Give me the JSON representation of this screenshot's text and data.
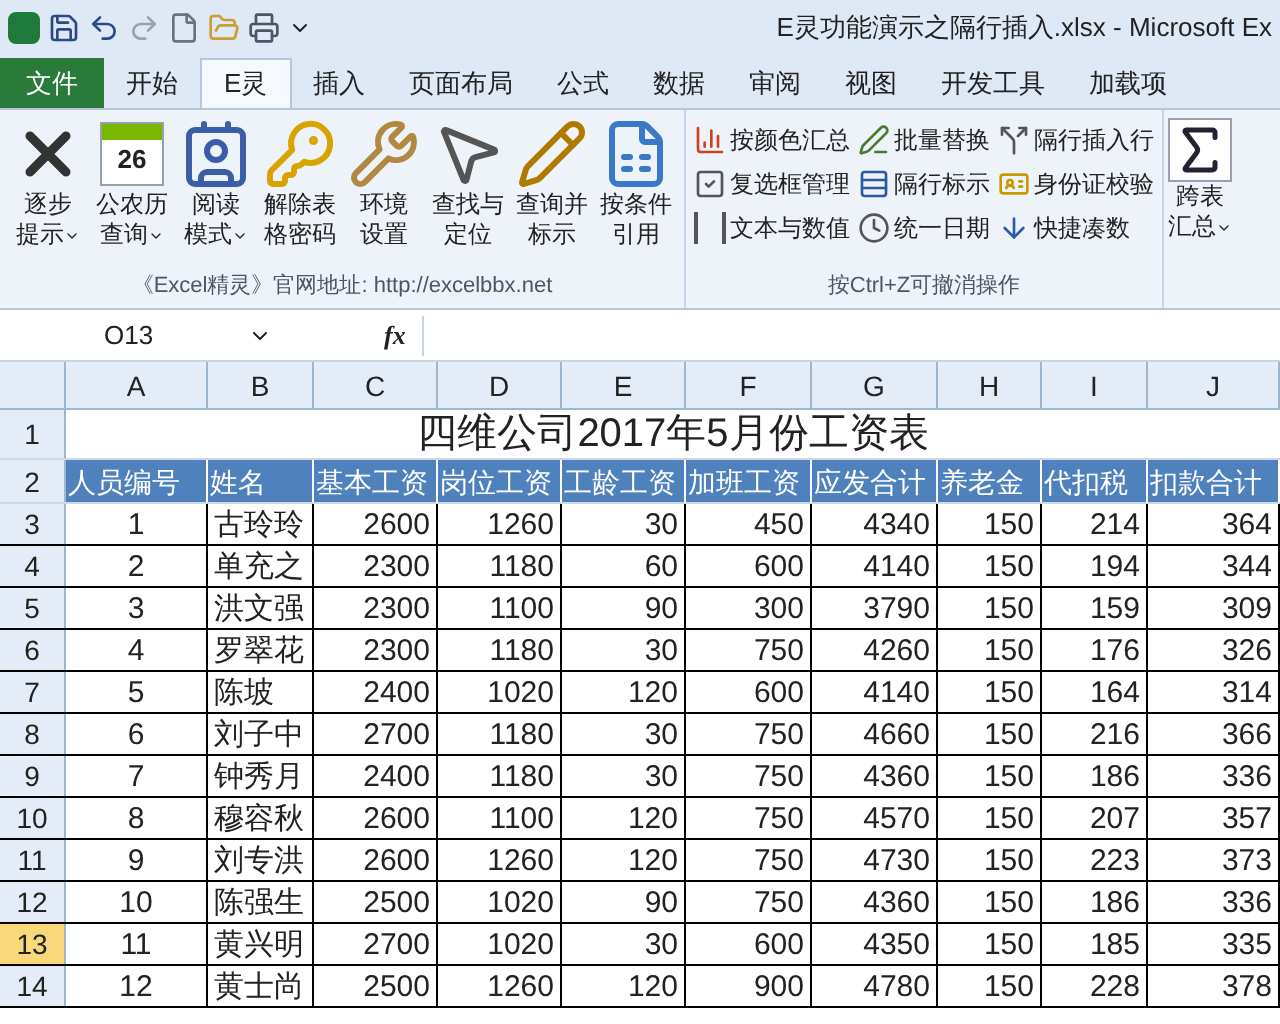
{
  "window": {
    "title": "E灵功能演示之隔行插入.xlsx - Microsoft Ex"
  },
  "tabs": [
    {
      "label": "文件",
      "selected": false,
      "kind": "file"
    },
    {
      "label": "开始",
      "selected": false
    },
    {
      "label": "E灵",
      "selected": true
    },
    {
      "label": "插入",
      "selected": false
    },
    {
      "label": "页面布局",
      "selected": false
    },
    {
      "label": "公式",
      "selected": false
    },
    {
      "label": "数据",
      "selected": false
    },
    {
      "label": "审阅",
      "selected": false
    },
    {
      "label": "视图",
      "selected": false
    },
    {
      "label": "开发工具",
      "selected": false
    },
    {
      "label": "加载项",
      "selected": false
    }
  ],
  "ribbon": {
    "group_1": {
      "buttons": [
        {
          "kind": "cross",
          "lines": [
            "逐步",
            "提示"
          ],
          "dropdown": true
        },
        {
          "kind": "calendar",
          "icon_text": "26",
          "lines": [
            "公农历",
            "查询"
          ],
          "dropdown": true
        },
        {
          "kind": "card",
          "lines": [
            "阅读",
            "模式"
          ],
          "dropdown": true
        },
        {
          "kind": "key",
          "lines": [
            "解除表",
            "格密码"
          ],
          "dropdown": false
        },
        {
          "kind": "tools",
          "lines": [
            "环境",
            "设置"
          ],
          "dropdown": false
        },
        {
          "kind": "pointer",
          "lines": [
            "查找与",
            "定位"
          ],
          "dropdown": false
        },
        {
          "kind": "pencil",
          "lines": [
            "查询并",
            "标示"
          ],
          "dropdown": false
        },
        {
          "kind": "sheet",
          "lines": [
            "按条件",
            "引用"
          ],
          "dropdown": false
        }
      ],
      "label": "《Excel精灵》官网地址: http://excelbbx.net"
    },
    "group_2": {
      "buttons": [
        {
          "kind": "bars",
          "label": "按颜色汇总"
        },
        {
          "kind": "check",
          "label": "复选框管理"
        },
        {
          "kind": "brackets",
          "label": "文本与数值"
        },
        {
          "kind": "pen",
          "label": "批量替换"
        },
        {
          "kind": "rows",
          "label": "隔行标示"
        },
        {
          "kind": "clock",
          "label": "统一日期"
        },
        {
          "kind": "insert",
          "label": "隔行插入行"
        },
        {
          "kind": "id",
          "label": "身份证校验"
        },
        {
          "kind": "down",
          "label": "快捷凑数"
        }
      ],
      "label": "按Ctrl+Z可撤消操作"
    },
    "group_3": {
      "lines": [
        "跨表",
        "汇总"
      ],
      "dropdown": true
    }
  },
  "formula_bar": {
    "name_box": "O13",
    "function_label": "fx"
  },
  "sheet": {
    "columns": [
      "A",
      "B",
      "C",
      "D",
      "E",
      "F",
      "G",
      "H",
      "I",
      "J"
    ],
    "title_row": {
      "number": "1",
      "title": "四维公司2017年5月份工资表"
    },
    "header_row": {
      "number": "2",
      "cells": [
        "人员编号",
        "姓名",
        "基本工资",
        "岗位工资",
        "工龄工资",
        "加班工资",
        "应发合计",
        "养老金",
        "代扣税",
        "扣款合计"
      ]
    },
    "rows": [
      {
        "number": "3",
        "selected": false,
        "cells": [
          "1",
          "古玲玲",
          "2600",
          "1260",
          "30",
          "450",
          "4340",
          "150",
          "214",
          "364"
        ]
      },
      {
        "number": "4",
        "selected": false,
        "cells": [
          "2",
          "单充之",
          "2300",
          "1180",
          "60",
          "600",
          "4140",
          "150",
          "194",
          "344"
        ]
      },
      {
        "number": "5",
        "selected": false,
        "cells": [
          "3",
          "洪文强",
          "2300",
          "1100",
          "90",
          "300",
          "3790",
          "150",
          "159",
          "309"
        ]
      },
      {
        "number": "6",
        "selected": false,
        "cells": [
          "4",
          "罗翠花",
          "2300",
          "1180",
          "30",
          "750",
          "4260",
          "150",
          "176",
          "326"
        ]
      },
      {
        "number": "7",
        "selected": false,
        "cells": [
          "5",
          "陈坡",
          "2400",
          "1020",
          "120",
          "600",
          "4140",
          "150",
          "164",
          "314"
        ]
      },
      {
        "number": "8",
        "selected": false,
        "cells": [
          "6",
          "刘子中",
          "2700",
          "1180",
          "30",
          "750",
          "4660",
          "150",
          "216",
          "366"
        ]
      },
      {
        "number": "9",
        "selected": false,
        "cells": [
          "7",
          "钟秀月",
          "2400",
          "1180",
          "30",
          "750",
          "4360",
          "150",
          "186",
          "336"
        ]
      },
      {
        "number": "10",
        "selected": false,
        "cells": [
          "8",
          "穆容秋",
          "2600",
          "1100",
          "120",
          "750",
          "4570",
          "150",
          "207",
          "357"
        ]
      },
      {
        "number": "11",
        "selected": false,
        "cells": [
          "9",
          "刘专洪",
          "2600",
          "1260",
          "120",
          "750",
          "4730",
          "150",
          "223",
          "373"
        ]
      },
      {
        "number": "12",
        "selected": false,
        "cells": [
          "10",
          "陈强生",
          "2500",
          "1020",
          "90",
          "750",
          "4360",
          "150",
          "186",
          "336"
        ]
      },
      {
        "number": "13",
        "selected": true,
        "cells": [
          "11",
          "黄兴明",
          "2700",
          "1020",
          "30",
          "600",
          "4350",
          "150",
          "185",
          "335"
        ]
      },
      {
        "number": "14",
        "selected": false,
        "cells": [
          "12",
          "黄士尚",
          "2500",
          "1260",
          "120",
          "900",
          "4780",
          "150",
          "228",
          "378"
        ]
      }
    ]
  }
}
